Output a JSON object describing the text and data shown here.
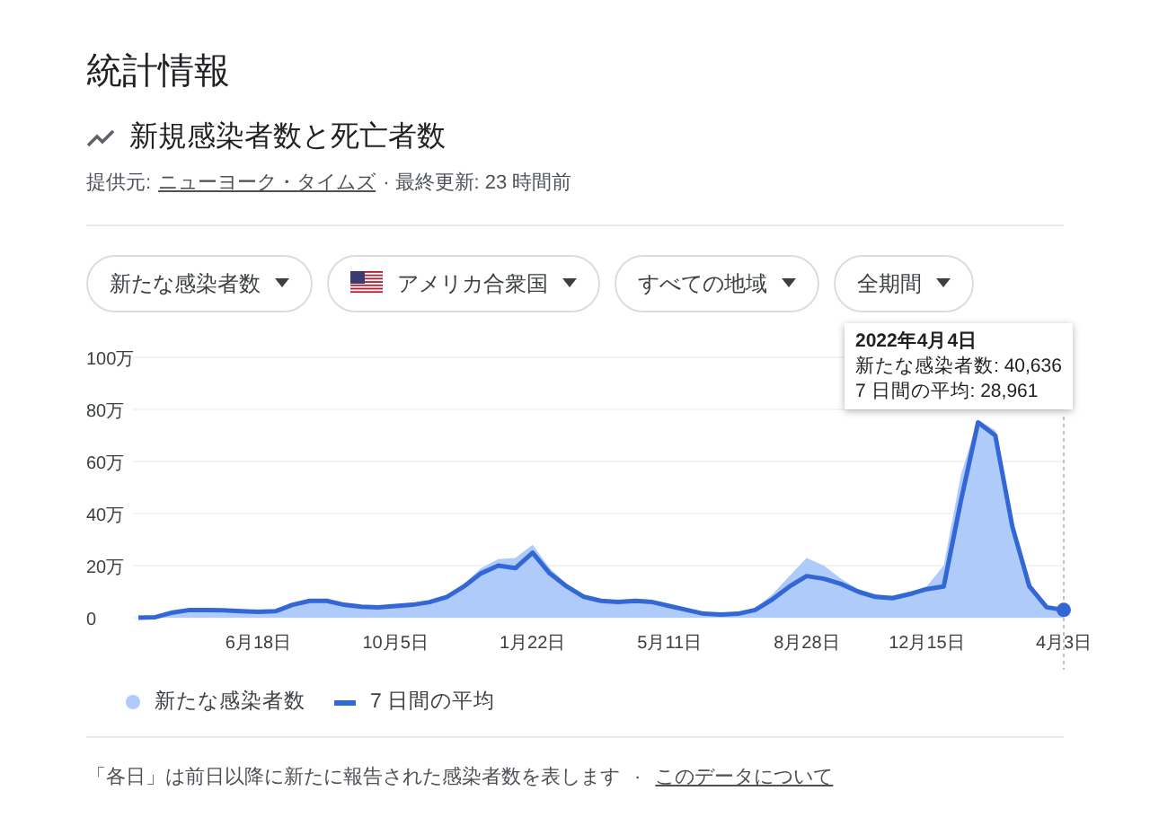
{
  "title": "統計情報",
  "subtitle": "新規感染者数と死亡者数",
  "source": {
    "label": "提供元:",
    "link": "ニューヨーク・タイムズ",
    "updated": "· 最終更新: 23 時間前"
  },
  "filters": [
    {
      "label": "新たな感染者数",
      "kind": "text"
    },
    {
      "label": "アメリカ合衆国",
      "kind": "flag"
    },
    {
      "label": "すべての地域",
      "kind": "text"
    },
    {
      "label": "全期間",
      "kind": "text"
    }
  ],
  "chart": {
    "chart_data": {
      "type": "area",
      "categories": [
        null,
        null,
        null,
        null,
        null,
        null,
        null,
        "6月18日",
        null,
        null,
        null,
        null,
        null,
        null,
        null,
        "10月5日",
        null,
        null,
        null,
        null,
        null,
        null,
        null,
        "1月22日",
        null,
        null,
        null,
        null,
        null,
        null,
        null,
        "5月11日",
        null,
        null,
        null,
        null,
        null,
        null,
        null,
        "8月28日",
        null,
        null,
        null,
        null,
        null,
        null,
        "12月15日",
        null,
        null,
        null,
        null,
        null,
        null,
        null,
        "4月3日"
      ],
      "series": [
        {
          "name": "新たな感染者数",
          "type": "area",
          "color": "#aecbfa",
          "values": [
            0,
            0.3,
            2.5,
            3.2,
            3,
            2.9,
            2.6,
            2.3,
            2.7,
            5.2,
            6.8,
            6.6,
            5.2,
            4.4,
            4.1,
            4.7,
            5.2,
            6.3,
            8.5,
            13,
            19,
            22.5,
            23,
            28,
            19,
            13,
            8.5,
            7,
            6.2,
            6.9,
            6.2,
            4.7,
            3.1,
            1.6,
            1.3,
            1.7,
            3.5,
            9,
            16,
            23,
            20,
            15,
            11,
            9,
            8.5,
            10,
            12,
            20,
            55,
            76,
            72,
            38,
            13,
            4.5,
            4
          ]
        },
        {
          "name": "7 日間の平均",
          "type": "line",
          "color": "#3367d6",
          "values": [
            0,
            0.2,
            2,
            3,
            3,
            2.8,
            2.5,
            2.2,
            2.5,
            5,
            6.5,
            6.5,
            5,
            4.2,
            4,
            4.5,
            5,
            6,
            8,
            12,
            17,
            20,
            19,
            25,
            17,
            12,
            8,
            6.5,
            6,
            6.5,
            6,
            4.5,
            3,
            1.5,
            1.2,
            1.5,
            3,
            7,
            12,
            16,
            15,
            13,
            10,
            8,
            7.5,
            9,
            11,
            12,
            45,
            75,
            70,
            35,
            12,
            4,
            3
          ]
        }
      ],
      "grid": true,
      "ylim": [
        0,
        100
      ],
      "yticks": [
        {
          "value": 0,
          "label": "0"
        },
        {
          "value": 20,
          "label": "20万"
        },
        {
          "value": 40,
          "label": "40万"
        },
        {
          "value": 60,
          "label": "60万"
        },
        {
          "value": 80,
          "label": "80万"
        },
        {
          "value": 100,
          "label": "100万"
        }
      ]
    },
    "tooltip": {
      "title": "2022年4月4日",
      "lines": [
        "新たな感染者数: 40,636",
        "7 日間の平均: 28,961"
      ]
    }
  },
  "footer": {
    "note": "「各日」は前日以降に新たに報告された感染者数を表します",
    "separator": "·",
    "link": "このデータについて"
  }
}
